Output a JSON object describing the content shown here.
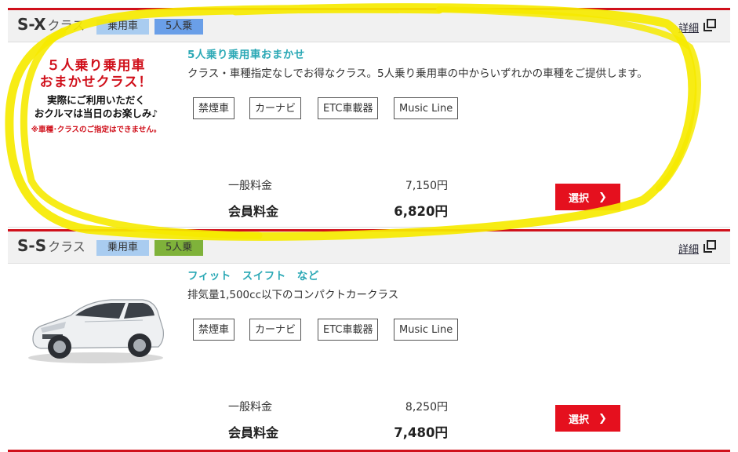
{
  "colors": {
    "accent_red": "#d0101b",
    "button_red": "#e5101e",
    "teal": "#2aa8b5",
    "highlight_yellow": "#f6ea00"
  },
  "cards": [
    {
      "class_code": "S-X",
      "class_suffix": "クラス",
      "tags": [
        {
          "label": "乗用車",
          "color": "#a9ccf0"
        },
        {
          "label": "5人乗",
          "color": "#6a9fe8"
        }
      ],
      "detail_label": "詳細",
      "promo": {
        "title": "５人乗り乗用車\nおまかせクラス！",
        "subtitle": "実際にご利用いただく\nおクルマは当日のお楽しみ♪",
        "note": "※車種･クラスのご指定はできません。"
      },
      "subtitle": "5人乗り乗用車おまかせ",
      "description": "クラス・車種指定なしでお得なクラス。5人乗り乗用車の中からいずれかの車種をご提供します。",
      "features": [
        "禁煙車",
        "カーナビ",
        "ETC車載器",
        "Music Line"
      ],
      "general_price_label": "一般料金",
      "general_price": "7,150円",
      "member_price_label": "会員料金",
      "member_price": "6,820円",
      "select_label": "選択",
      "select_icon": "chevron-right-icon"
    },
    {
      "class_code": "S-S",
      "class_suffix": "クラス",
      "tags": [
        {
          "label": "乗用車",
          "color": "#a9ccf0"
        },
        {
          "label": "5人乗",
          "color": "#7fb23a"
        }
      ],
      "detail_label": "詳細",
      "car_image": "white-compact-car-image",
      "subtitle": "フィット　スイフト　など",
      "description": "排気量1,500cc以下のコンパクトカークラス",
      "features": [
        "禁煙車",
        "カーナビ",
        "ETC車載器",
        "Music Line"
      ],
      "general_price_label": "一般料金",
      "general_price": "8,250円",
      "member_price_label": "会員料金",
      "member_price": "7,480円",
      "select_label": "選択",
      "select_icon": "chevron-right-icon"
    }
  ]
}
